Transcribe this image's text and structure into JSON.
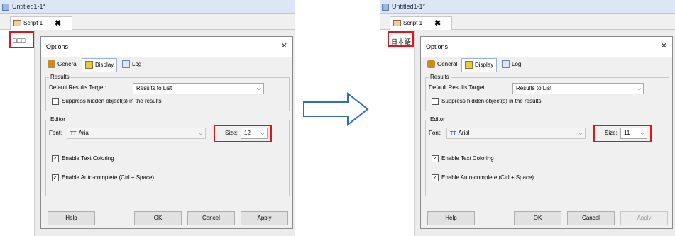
{
  "before": {
    "window_title": "Untitled1-1*",
    "tab_label": "Script 1",
    "tab_close": "✖",
    "editor_text": "□□□",
    "dialog": {
      "title": "Options",
      "close": "✕",
      "tabs": [
        "General",
        "Display",
        "Log"
      ],
      "results_group": "Results",
      "default_target_label": "Default Results Target:",
      "default_target_value": "Results to List",
      "suppress_label": "Suppress hidden object(s) in the results",
      "suppress_checked": false,
      "editor_group": "Editor",
      "font_label": "Font:",
      "font_value": "Arial",
      "size_label": "Size:",
      "size_value": "12",
      "text_coloring_label": "Enable Text Coloring",
      "autocomplete_label": "Enable Auto-complete (Ctrl + Space)",
      "buttons": {
        "help": "Help",
        "ok": "OK",
        "cancel": "Cancel",
        "apply": "Apply"
      },
      "apply_enabled": true
    }
  },
  "after": {
    "window_title": "Untitled1-1*",
    "tab_label": "Script 1",
    "tab_close": "✖",
    "editor_text": "日本語",
    "dialog": {
      "title": "Options",
      "close": "✕",
      "tabs": [
        "General",
        "Display",
        "Log"
      ],
      "results_group": "Results",
      "default_target_label": "Default Results Target:",
      "default_target_value": "Results to List",
      "suppress_label": "Suppress hidden object(s) in the results",
      "suppress_checked": false,
      "editor_group": "Editor",
      "font_label": "Font:",
      "font_value": "Arial",
      "size_label": "Size:",
      "size_value": "11",
      "text_coloring_label": "Enable Text Coloring",
      "autocomplete_label": "Enable Auto-complete (Ctrl + Space)",
      "buttons": {
        "help": "Help",
        "ok": "OK",
        "cancel": "Cancel",
        "apply": "Apply"
      },
      "apply_enabled": false
    }
  },
  "colors": {
    "highlight": "#e1141e",
    "arrow": "#2f6eb8"
  },
  "icons": {
    "transition_arrow": "right-arrow-icon"
  }
}
